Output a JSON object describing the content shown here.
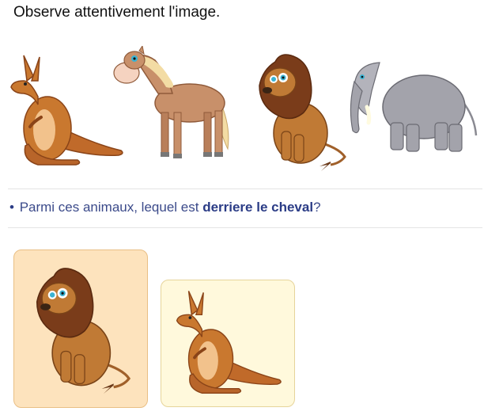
{
  "instruction": "Observe attentivement l'image.",
  "scene": {
    "animals": [
      "kangaroo-icon",
      "horse-icon",
      "lion-icon",
      "elephant-icon"
    ]
  },
  "question": {
    "bullet": "•",
    "prefix": "Parmi ces animaux, lequel est ",
    "emphasis": "derriere le cheval",
    "suffix": "?"
  },
  "choices": [
    {
      "animal": "lion-icon",
      "selected": true
    },
    {
      "animal": "kangaroo-icon",
      "selected": false
    }
  ],
  "colors": {
    "question_text": "#3b4a8a",
    "selected_bg": "#fde3bd",
    "choice_bg": "#fff9dc"
  }
}
